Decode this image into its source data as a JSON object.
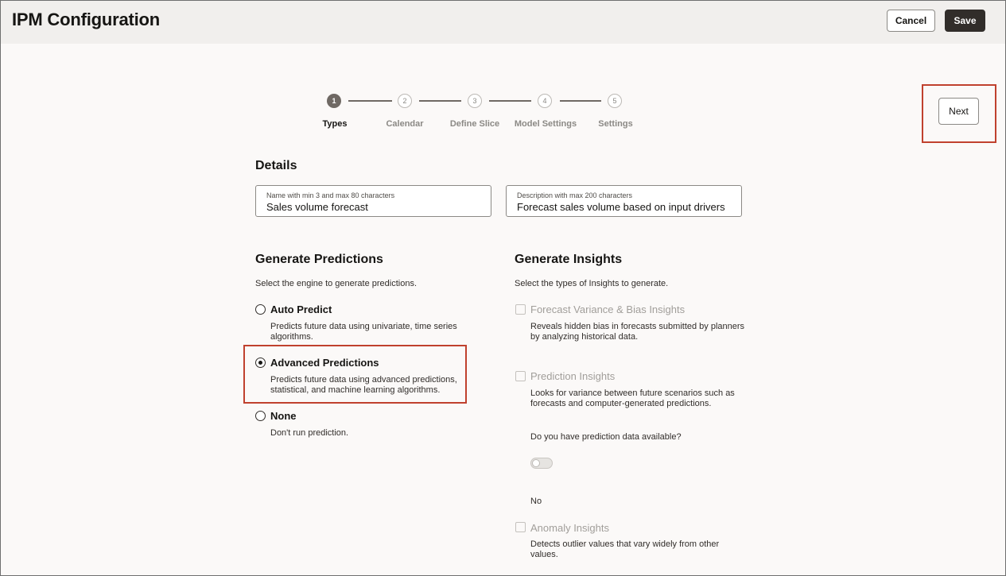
{
  "header": {
    "title": "IPM Configuration",
    "cancel_label": "Cancel",
    "save_label": "Save"
  },
  "navigation": {
    "next_label": "Next"
  },
  "stepper": {
    "steps": [
      {
        "number": "1",
        "label": "Types",
        "active": true
      },
      {
        "number": "2",
        "label": "Calendar",
        "active": false
      },
      {
        "number": "3",
        "label": "Define Slice",
        "active": false
      },
      {
        "number": "4",
        "label": "Model Settings",
        "active": false
      },
      {
        "number": "5",
        "label": "Settings",
        "active": false
      }
    ]
  },
  "details": {
    "title": "Details",
    "name_field": {
      "label": "Name with min 3 and max 80 characters",
      "value": "Sales volume forecast"
    },
    "description_field": {
      "label": "Description with max 200 characters",
      "value": "Forecast sales volume based on input drivers"
    }
  },
  "predictions": {
    "title": "Generate Predictions",
    "helper": "Select the engine to generate predictions.",
    "options": [
      {
        "label": "Auto Predict",
        "description_lines": [
          "Predicts future data using univariate, time series",
          "algorithms."
        ],
        "selected": false
      },
      {
        "label": "Advanced Predictions",
        "description_lines": [
          "Predicts future data using advanced predictions,",
          "statistical, and machine learning algorithms."
        ],
        "selected": true
      },
      {
        "label": "None",
        "description_lines": [
          "Don't run prediction."
        ],
        "selected": false
      }
    ]
  },
  "insights": {
    "title": "Generate Insights",
    "helper": "Select the types of Insights to generate.",
    "options": [
      {
        "label": "Forecast Variance & Bias Insights",
        "description_lines": [
          "Reveals hidden bias in forecasts submitted by planners",
          "by analyzing historical data."
        ],
        "checked": false
      },
      {
        "label": "Prediction Insights",
        "description_lines": [
          "Looks for variance between future scenarios such as",
          "forecasts and computer-generated predictions."
        ],
        "checked": false
      },
      {
        "label": "Anomaly Insights",
        "description_lines": [
          "Detects outlier values that vary widely from other",
          "values."
        ],
        "checked": false
      }
    ],
    "prediction_data_question": "Do you have prediction data available?",
    "prediction_data_toggle_value": "No"
  },
  "colors": {
    "primary_button": "#312d2a",
    "highlight": "#c0412e",
    "background": "#fbf9f8",
    "header": "#f1efed"
  }
}
